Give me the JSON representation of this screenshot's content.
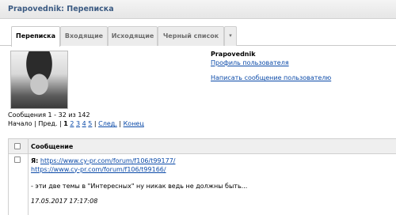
{
  "page_title": "Prapovednik: Переписка",
  "tabs": [
    "Переписка",
    "Входящие",
    "Исходящие",
    "Черный список",
    "▾"
  ],
  "user": {
    "name": "Prapovednik",
    "profile_link": "Профиль пользователя",
    "message_link": "Написать сообщение пользователю"
  },
  "messages_range": "Сообщения 1 - 32 из 142",
  "pager": {
    "start": "Начало",
    "prev": "Пред.",
    "pages": [
      "1",
      "2",
      "3",
      "4",
      "5"
    ],
    "next": "След.",
    "end": "Конец"
  },
  "table": {
    "header": "Сообщение",
    "row": {
      "author": "Я:",
      "link1": "https://www.cy-pr.com/forum/f106/t99177/",
      "link2": "https://www.cy-pr.com/forum/f106/t99166/",
      "text": "- эти две темы в \"Интересных\" ну никак ведь не должны быть...",
      "timestamp": "17.05.2017 17:17:08"
    }
  }
}
